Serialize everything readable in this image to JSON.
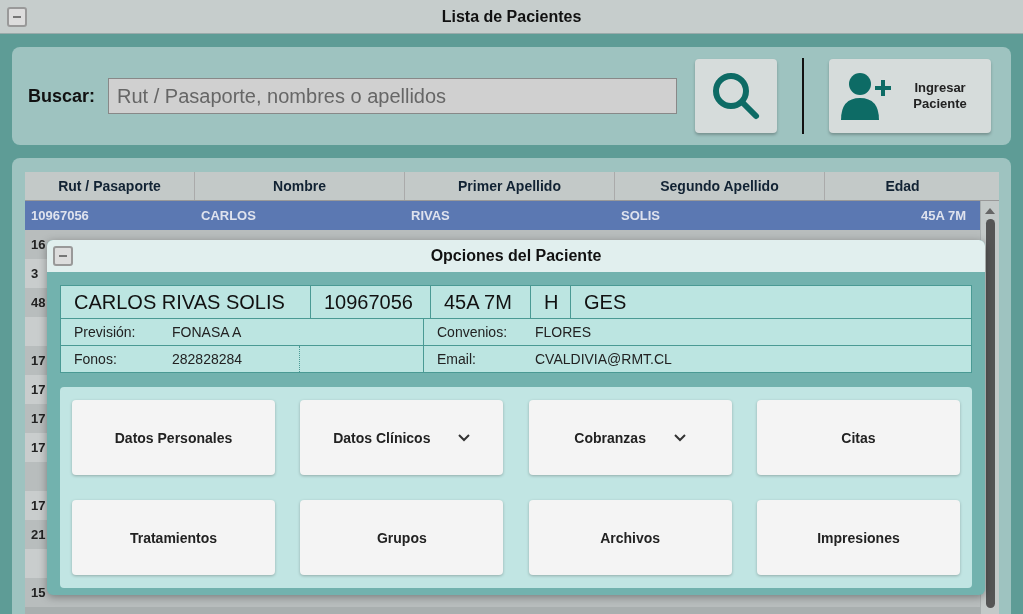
{
  "window": {
    "title": "Lista de Pacientes"
  },
  "search": {
    "label": "Buscar:",
    "placeholder": "Rut / Pasaporte, nombres o apellidos"
  },
  "add_button": {
    "label": "Ingresar Paciente"
  },
  "table": {
    "columns": [
      "Rut / Pasaporte",
      "Nombre",
      "Primer Apellido",
      "Segundo Apellido",
      "Edad"
    ],
    "rows": [
      {
        "cells": [
          "10967056",
          "CARLOS",
          "RIVAS",
          "SOLIS",
          "45A 7M"
        ],
        "selected": true
      },
      {
        "cells": [
          "16"
        ],
        "selected": false
      },
      {
        "cells": [
          "3"
        ],
        "selected": false
      },
      {
        "cells": [
          "48"
        ],
        "selected": false
      },
      {
        "cells": [],
        "selected": false
      },
      {
        "cells": [
          "17"
        ],
        "selected": false
      },
      {
        "cells": [
          "17"
        ],
        "selected": false
      },
      {
        "cells": [
          "17"
        ],
        "selected": false
      },
      {
        "cells": [
          "17"
        ],
        "selected": false
      },
      {
        "cells": [],
        "selected": false
      },
      {
        "cells": [
          "17"
        ],
        "selected": false
      },
      {
        "cells": [
          "21"
        ],
        "selected": false
      },
      {
        "cells": [],
        "selected": false
      },
      {
        "cells": [
          "15"
        ],
        "selected": false
      }
    ]
  },
  "dialog": {
    "title": "Opciones del Paciente",
    "summary": [
      "CARLOS RIVAS SOLIS",
      "10967056",
      "45A 7M",
      "H",
      "GES"
    ],
    "fields": [
      {
        "label": "Previsión:",
        "value": "FONASA A"
      },
      {
        "label": "Convenios:",
        "value": "FLORES"
      },
      {
        "label": "Fonos:",
        "value": "282828284"
      },
      {
        "label": "Email:",
        "value": "CVALDIVIA@RMT.CL"
      }
    ],
    "actions": [
      {
        "label": "Datos Personales",
        "dropdown": false
      },
      {
        "label": "Datos Clínicos",
        "dropdown": true
      },
      {
        "label": "Cobranzas",
        "dropdown": true
      },
      {
        "label": "Citas",
        "dropdown": false
      },
      {
        "label": "Tratamientos",
        "dropdown": false
      },
      {
        "label": "Grupos",
        "dropdown": false
      },
      {
        "label": "Archivos",
        "dropdown": false
      },
      {
        "label": "Impresiones",
        "dropdown": false
      }
    ]
  }
}
